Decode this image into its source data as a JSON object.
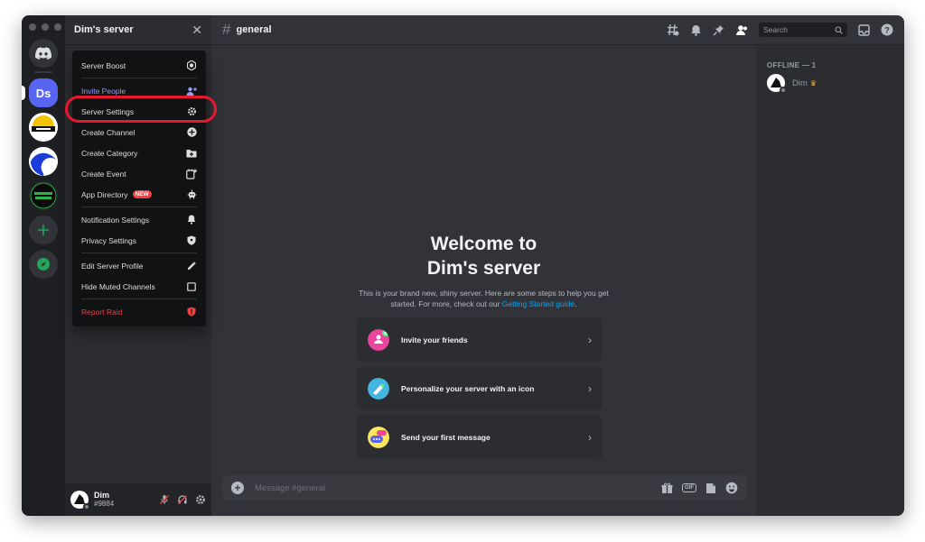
{
  "server": {
    "name": "Dim's server",
    "rail_ds_label": "Ds",
    "close_glyph": "✕"
  },
  "menu": {
    "items": [
      {
        "label": "Server Boost",
        "icon": "boost-icon"
      },
      {
        "label": "Invite People",
        "icon": "add-person-icon"
      },
      {
        "label": "Server Settings",
        "icon": "gear-icon"
      },
      {
        "label": "Create Channel",
        "icon": "plus-circle-icon"
      },
      {
        "label": "Create Category",
        "icon": "folder-plus-icon"
      },
      {
        "label": "Create Event",
        "icon": "calendar-plus-icon"
      },
      {
        "label": "App Directory",
        "icon": "robot-icon",
        "badge": "NEW"
      },
      {
        "label": "Notification Settings",
        "icon": "bell-icon"
      },
      {
        "label": "Privacy Settings",
        "icon": "shield-icon"
      },
      {
        "label": "Edit Server Profile",
        "icon": "pencil-icon"
      },
      {
        "label": "Hide Muted Channels",
        "icon": "checkbox-icon"
      },
      {
        "label": "Report Raid",
        "icon": "shield-alert-icon"
      }
    ]
  },
  "channel": {
    "hash": "#",
    "name": "general"
  },
  "search": {
    "placeholder": "Search"
  },
  "welcome": {
    "title_line1": "Welcome to",
    "title_line2": "Dim's server",
    "desc": "This is your brand new, shiny server. Here are some steps to help you get started. For more, check out our ",
    "link": "Getting Started guide",
    "period": "."
  },
  "cards": [
    {
      "label": "Invite your friends",
      "icon": "invite-friends-icon"
    },
    {
      "label": "Personalize your server with an icon",
      "icon": "personalize-icon"
    },
    {
      "label": "Send your first message",
      "icon": "message-icon"
    }
  ],
  "chevron": "›",
  "composer": {
    "placeholder": "Message #general",
    "gif_label": "GIF"
  },
  "members": {
    "section_header": "OFFLINE — 1",
    "items": [
      {
        "name": "Dim",
        "crown": "♛"
      }
    ]
  },
  "user": {
    "name": "Dim",
    "tag": "#9884"
  },
  "colors": {
    "accent": "#5865f2",
    "highlight": "#e8192c",
    "link": "#00a8fc",
    "danger": "#f23f43",
    "online_green": "#23a55a"
  }
}
